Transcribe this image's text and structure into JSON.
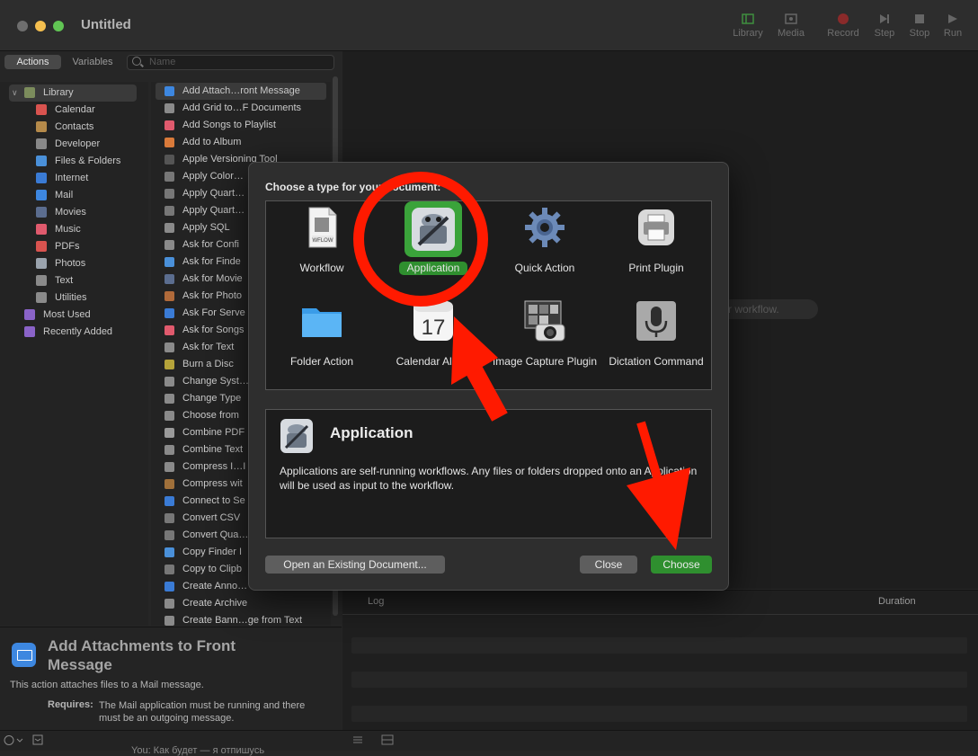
{
  "window": {
    "title": "Untitled"
  },
  "toolbar": {
    "items": [
      "Library",
      "Media",
      "Record",
      "Step",
      "Stop",
      "Run"
    ]
  },
  "left_tabs": {
    "actions": "Actions",
    "variables": "Variables"
  },
  "search": {
    "placeholder": "Name"
  },
  "library": {
    "items": [
      {
        "label": "Library",
        "color": "#7c8c5c"
      },
      {
        "label": "Calendar",
        "color": "#d9534f"
      },
      {
        "label": "Contacts",
        "color": "#b58a4a"
      },
      {
        "label": "Developer",
        "color": "#888888"
      },
      {
        "label": "Files & Folders",
        "color": "#4a90d9"
      },
      {
        "label": "Internet",
        "color": "#3a7bd5"
      },
      {
        "label": "Mail",
        "color": "#3d87e0"
      },
      {
        "label": "Movies",
        "color": "#5b6d8f"
      },
      {
        "label": "Music",
        "color": "#e05a6d"
      },
      {
        "label": "PDFs",
        "color": "#d9534f"
      },
      {
        "label": "Photos",
        "color": "#9aa3ad"
      },
      {
        "label": "Text",
        "color": "#8a8a8a"
      },
      {
        "label": "Utilities",
        "color": "#8a8a8a"
      },
      {
        "label": "Most Used",
        "color": "#8a63c8"
      },
      {
        "label": "Recently Added",
        "color": "#8a63c8"
      }
    ]
  },
  "actions": {
    "items": [
      "Add Attach…ront Message",
      "Add Grid to…F Documents",
      "Add Songs to Playlist",
      "Add to Album",
      "Apple Versioning Tool",
      "Apply Color…",
      "Apply Quart…",
      "Apply Quart…",
      "Apply SQL",
      "Ask for Confi",
      "Ask for Finde",
      "Ask for Movie",
      "Ask for Photo",
      "Ask For Serve",
      "Ask for Songs",
      "Ask for Text",
      "Burn a Disc",
      "Change Syst…",
      "Change Type",
      "Choose from",
      "Combine PDF",
      "Combine Text",
      "Compress I…I",
      "Compress wit",
      "Connect to Se",
      "Convert CSV",
      "Convert Qua…",
      "Copy Finder I",
      "Copy to Clipb",
      "Create Anno…",
      "Create Archive",
      "Create Bann…ge from Text"
    ]
  },
  "description": {
    "title": "Add Attachments to Front Message",
    "text": "This action attaches files to a Mail message.",
    "requires_label": "Requires:",
    "requires_text": "The Mail application must be running and there must be an outgoing message."
  },
  "bottom_ghost_text": "You: Как будет — я отпишусь",
  "canvas": {
    "hint": "r workflow."
  },
  "log": {
    "col_log": "Log",
    "col_duration": "Duration"
  },
  "dialog": {
    "prompt": "Choose a type for your document:",
    "types": [
      {
        "label": "Workflow",
        "selected": false,
        "icon": "wflow-document-icon"
      },
      {
        "label": "Application",
        "selected": true,
        "icon": "automator-robot-icon"
      },
      {
        "label": "Quick Action",
        "selected": false,
        "icon": "gear-icon"
      },
      {
        "label": "Print Plugin",
        "selected": false,
        "icon": "printer-icon"
      },
      {
        "label": "Folder Action",
        "selected": false,
        "icon": "folder-icon"
      },
      {
        "label": "Calendar Alarm",
        "selected": false,
        "icon": "calendar-icon"
      },
      {
        "label": "Image Capture Plugin",
        "selected": false,
        "icon": "camera-icon"
      },
      {
        "label": "Dictation Command",
        "selected": false,
        "icon": "microphone-icon"
      }
    ],
    "calendar_day": "17",
    "wflow_tag": "WFLOW",
    "selected_title": "Application",
    "selected_text": "Applications are self-running workflows. Any files or folders dropped onto an Application will be used as input to the workflow.",
    "buttons": {
      "open_existing": "Open an Existing Document...",
      "close": "Close",
      "choose": "Choose"
    }
  },
  "colors": {
    "accent_green": "#2f8f2f",
    "annotation_red": "#ff1a00"
  }
}
